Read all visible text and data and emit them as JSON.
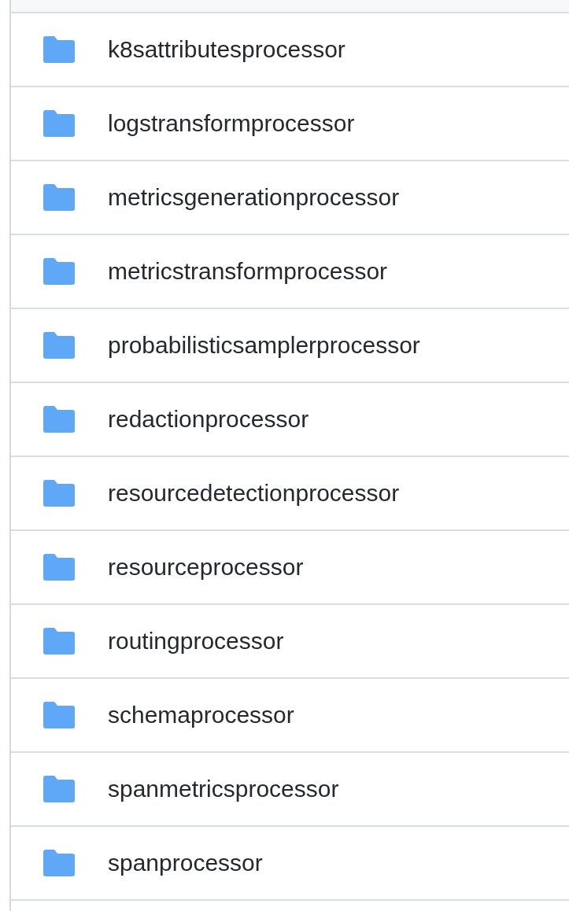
{
  "files": [
    {
      "name": "k8sattributesprocessor"
    },
    {
      "name": "logstransformprocessor"
    },
    {
      "name": "metricsgenerationprocessor"
    },
    {
      "name": "metricstransformprocessor"
    },
    {
      "name": "probabilisticsamplerprocessor"
    },
    {
      "name": "redactionprocessor"
    },
    {
      "name": "resourcedetectionprocessor"
    },
    {
      "name": "resourceprocessor"
    },
    {
      "name": "routingprocessor"
    },
    {
      "name": "schemaprocessor"
    },
    {
      "name": "spanmetricsprocessor"
    },
    {
      "name": "spanprocessor"
    }
  ]
}
